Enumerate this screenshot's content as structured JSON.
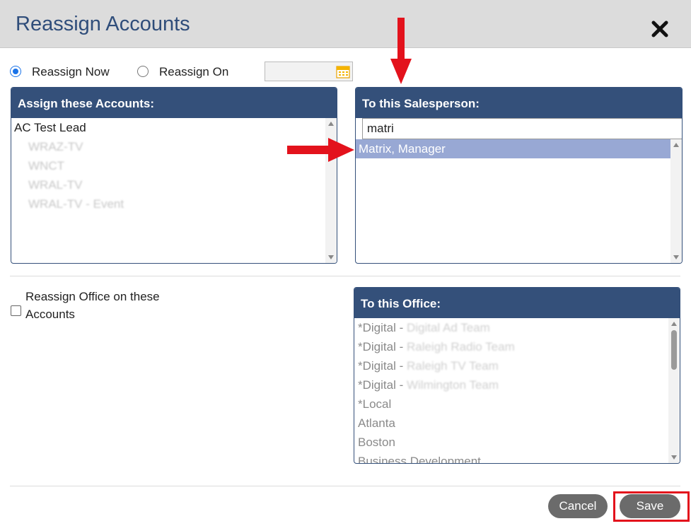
{
  "dialog": {
    "title": "Reassign Accounts"
  },
  "options": {
    "reassign_now_label": "Reassign Now",
    "reassign_on_label": "Reassign On",
    "selected": "Reassign Now",
    "date_value": ""
  },
  "accounts_panel": {
    "header": "Assign these Accounts:",
    "items": [
      "AC Test Lead",
      "WRAZ-TV",
      "WNCT",
      "WRAL-TV",
      "WRAL-TV - Event"
    ]
  },
  "salesperson_panel": {
    "header": "To this Salesperson:",
    "search_value": "matri",
    "items": [
      "Matrix, Manager"
    ],
    "selected": "Matrix, Manager"
  },
  "office_section": {
    "checkbox_label": "Reassign Office on these Accounts",
    "checked": false
  },
  "office_panel": {
    "header": "To this Office:",
    "items": [
      {
        "prefix": "*Digital - ",
        "rest": "Digital Ad Team"
      },
      {
        "prefix": "*Digital - ",
        "rest": "Raleigh Radio Team"
      },
      {
        "prefix": "*Digital - ",
        "rest": "Raleigh TV Team"
      },
      {
        "prefix": "*Digital - ",
        "rest": "Wilmington Team"
      },
      {
        "prefix": "*Local",
        "rest": ""
      },
      {
        "prefix": "Atlanta",
        "rest": ""
      },
      {
        "prefix": "Boston",
        "rest": ""
      },
      {
        "prefix": "Business Development",
        "rest": ""
      }
    ]
  },
  "footer": {
    "cancel_label": "Cancel",
    "save_label": "Save"
  },
  "colors": {
    "panel_header": "#34507a",
    "title_text": "#2f4d7a",
    "selection": "#98a8d4",
    "annotation_red": "#e3121c",
    "button": "#6b6b6b"
  }
}
